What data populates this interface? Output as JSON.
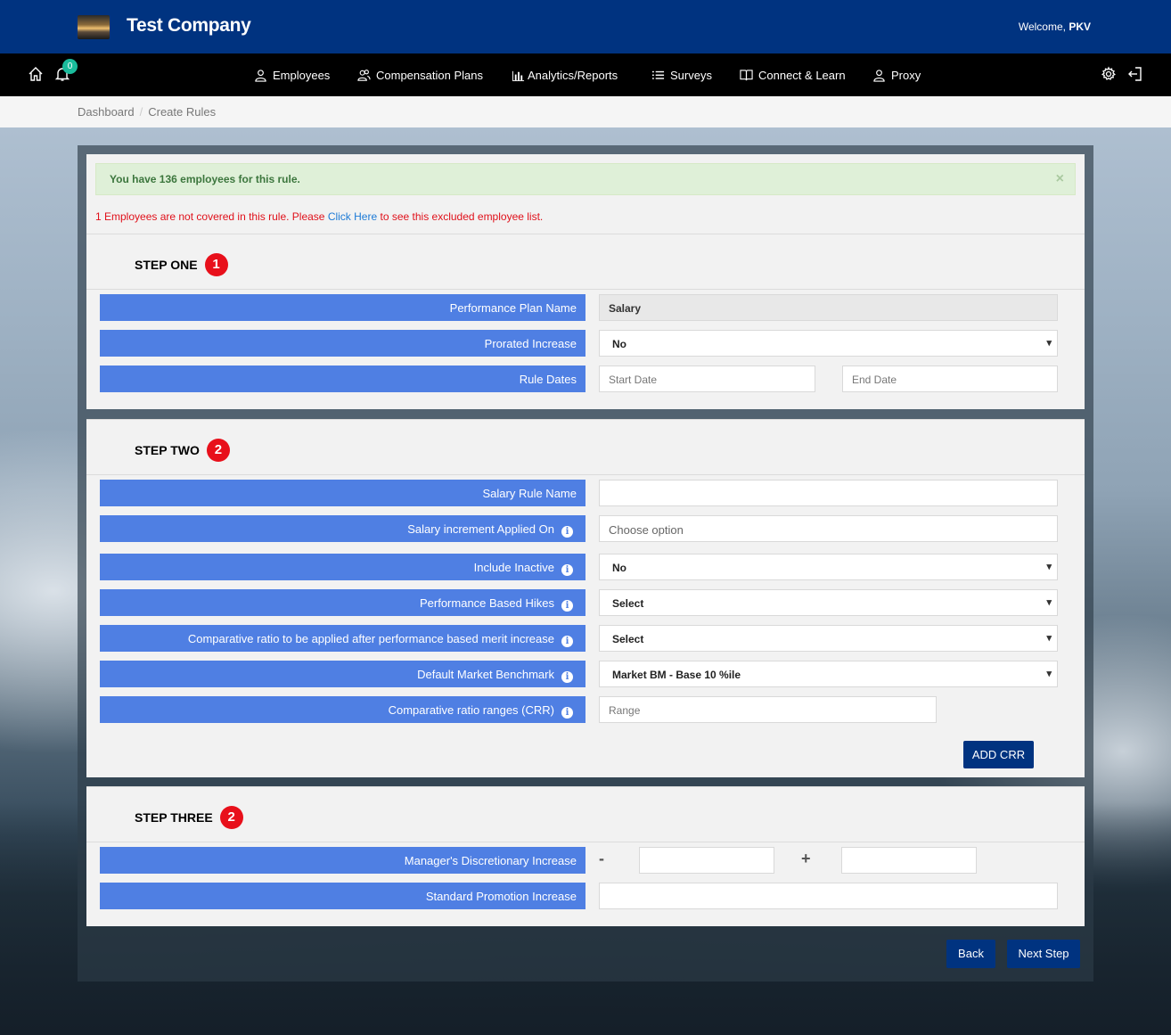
{
  "header": {
    "company": "Test Company",
    "welcome_prefix": "Welcome,",
    "user": "PKV"
  },
  "nav": {
    "notification_count": "0",
    "items": [
      {
        "label": "Employees",
        "icon": "user-icon"
      },
      {
        "label": "Compensation Plans",
        "icon": "users-icon"
      },
      {
        "label": "Analytics/Reports",
        "icon": "bar-chart-icon"
      },
      {
        "label": "Surveys",
        "icon": "list-icon"
      },
      {
        "label": "Connect & Learn",
        "icon": "book-icon"
      },
      {
        "label": "Proxy",
        "icon": "user-icon"
      }
    ]
  },
  "breadcrumb": [
    "Dashboard",
    "Create Rules"
  ],
  "alert": {
    "message": "You have 136 employees for this rule.",
    "close": "×"
  },
  "warning": {
    "before": "1 Employees are not covered in this rule. Please ",
    "link": "Click Here",
    "after": " to see this excluded employee list."
  },
  "step1": {
    "title": "STEP ONE",
    "number": "1",
    "plan_name_label": "Performance Plan Name",
    "plan_name_value": "Salary",
    "prorated_label": "Prorated Increase",
    "prorated_value": "No",
    "rule_dates_label": "Rule Dates",
    "start_date_placeholder": "Start Date",
    "end_date_placeholder": "End Date"
  },
  "step2": {
    "title": "STEP TWO",
    "number": "2",
    "salary_rule_name_label": "Salary Rule Name",
    "salary_rule_name_value": "",
    "increment_applied_label": "Salary increment Applied On",
    "increment_applied_placeholder": "Choose option",
    "include_inactive_label": "Include Inactive",
    "include_inactive_value": "No",
    "perf_hikes_label": "Performance Based Hikes",
    "perf_hikes_value": "Select",
    "comp_ratio_label": "Comparative ratio to be applied after performance based merit increase",
    "comp_ratio_value": "Select",
    "market_bm_label": "Default Market Benchmark",
    "market_bm_value": "Market BM - Base 10 %ile",
    "crr_label": "Comparative ratio ranges (CRR)",
    "crr_placeholder": "Range",
    "add_crr": "ADD CRR"
  },
  "step3": {
    "title": "STEP THREE",
    "number": "2",
    "mdi_label": "Manager's Discretionary Increase",
    "minus": "-",
    "plus": "+",
    "spi_label": "Standard Promotion Increase"
  },
  "actions": {
    "back": "Back",
    "next": "Next Step"
  },
  "colors": {
    "brand": "#003380",
    "label_blue": "#4f7fe3",
    "step_badge": "#e8101b",
    "alert_bg": "#dff0d8",
    "warning_text": "#e0101a"
  }
}
